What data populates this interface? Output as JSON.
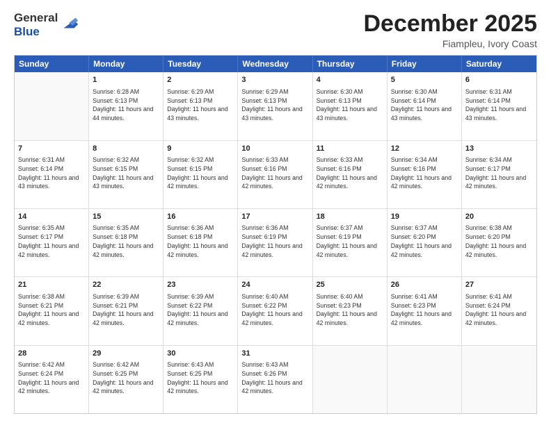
{
  "logo": {
    "general": "General",
    "blue": "Blue"
  },
  "title": "December 2025",
  "location": "Fiampleu, Ivory Coast",
  "header_days": [
    "Sunday",
    "Monday",
    "Tuesday",
    "Wednesday",
    "Thursday",
    "Friday",
    "Saturday"
  ],
  "weeks": [
    [
      {
        "day": "",
        "sunrise": "",
        "sunset": "",
        "daylight": ""
      },
      {
        "day": "1",
        "sunrise": "Sunrise: 6:28 AM",
        "sunset": "Sunset: 6:13 PM",
        "daylight": "Daylight: 11 hours and 44 minutes."
      },
      {
        "day": "2",
        "sunrise": "Sunrise: 6:29 AM",
        "sunset": "Sunset: 6:13 PM",
        "daylight": "Daylight: 11 hours and 43 minutes."
      },
      {
        "day": "3",
        "sunrise": "Sunrise: 6:29 AM",
        "sunset": "Sunset: 6:13 PM",
        "daylight": "Daylight: 11 hours and 43 minutes."
      },
      {
        "day": "4",
        "sunrise": "Sunrise: 6:30 AM",
        "sunset": "Sunset: 6:13 PM",
        "daylight": "Daylight: 11 hours and 43 minutes."
      },
      {
        "day": "5",
        "sunrise": "Sunrise: 6:30 AM",
        "sunset": "Sunset: 6:14 PM",
        "daylight": "Daylight: 11 hours and 43 minutes."
      },
      {
        "day": "6",
        "sunrise": "Sunrise: 6:31 AM",
        "sunset": "Sunset: 6:14 PM",
        "daylight": "Daylight: 11 hours and 43 minutes."
      }
    ],
    [
      {
        "day": "7",
        "sunrise": "Sunrise: 6:31 AM",
        "sunset": "Sunset: 6:14 PM",
        "daylight": "Daylight: 11 hours and 43 minutes."
      },
      {
        "day": "8",
        "sunrise": "Sunrise: 6:32 AM",
        "sunset": "Sunset: 6:15 PM",
        "daylight": "Daylight: 11 hours and 43 minutes."
      },
      {
        "day": "9",
        "sunrise": "Sunrise: 6:32 AM",
        "sunset": "Sunset: 6:15 PM",
        "daylight": "Daylight: 11 hours and 42 minutes."
      },
      {
        "day": "10",
        "sunrise": "Sunrise: 6:33 AM",
        "sunset": "Sunset: 6:16 PM",
        "daylight": "Daylight: 11 hours and 42 minutes."
      },
      {
        "day": "11",
        "sunrise": "Sunrise: 6:33 AM",
        "sunset": "Sunset: 6:16 PM",
        "daylight": "Daylight: 11 hours and 42 minutes."
      },
      {
        "day": "12",
        "sunrise": "Sunrise: 6:34 AM",
        "sunset": "Sunset: 6:16 PM",
        "daylight": "Daylight: 11 hours and 42 minutes."
      },
      {
        "day": "13",
        "sunrise": "Sunrise: 6:34 AM",
        "sunset": "Sunset: 6:17 PM",
        "daylight": "Daylight: 11 hours and 42 minutes."
      }
    ],
    [
      {
        "day": "14",
        "sunrise": "Sunrise: 6:35 AM",
        "sunset": "Sunset: 6:17 PM",
        "daylight": "Daylight: 11 hours and 42 minutes."
      },
      {
        "day": "15",
        "sunrise": "Sunrise: 6:35 AM",
        "sunset": "Sunset: 6:18 PM",
        "daylight": "Daylight: 11 hours and 42 minutes."
      },
      {
        "day": "16",
        "sunrise": "Sunrise: 6:36 AM",
        "sunset": "Sunset: 6:18 PM",
        "daylight": "Daylight: 11 hours and 42 minutes."
      },
      {
        "day": "17",
        "sunrise": "Sunrise: 6:36 AM",
        "sunset": "Sunset: 6:19 PM",
        "daylight": "Daylight: 11 hours and 42 minutes."
      },
      {
        "day": "18",
        "sunrise": "Sunrise: 6:37 AM",
        "sunset": "Sunset: 6:19 PM",
        "daylight": "Daylight: 11 hours and 42 minutes."
      },
      {
        "day": "19",
        "sunrise": "Sunrise: 6:37 AM",
        "sunset": "Sunset: 6:20 PM",
        "daylight": "Daylight: 11 hours and 42 minutes."
      },
      {
        "day": "20",
        "sunrise": "Sunrise: 6:38 AM",
        "sunset": "Sunset: 6:20 PM",
        "daylight": "Daylight: 11 hours and 42 minutes."
      }
    ],
    [
      {
        "day": "21",
        "sunrise": "Sunrise: 6:38 AM",
        "sunset": "Sunset: 6:21 PM",
        "daylight": "Daylight: 11 hours and 42 minutes."
      },
      {
        "day": "22",
        "sunrise": "Sunrise: 6:39 AM",
        "sunset": "Sunset: 6:21 PM",
        "daylight": "Daylight: 11 hours and 42 minutes."
      },
      {
        "day": "23",
        "sunrise": "Sunrise: 6:39 AM",
        "sunset": "Sunset: 6:22 PM",
        "daylight": "Daylight: 11 hours and 42 minutes."
      },
      {
        "day": "24",
        "sunrise": "Sunrise: 6:40 AM",
        "sunset": "Sunset: 6:22 PM",
        "daylight": "Daylight: 11 hours and 42 minutes."
      },
      {
        "day": "25",
        "sunrise": "Sunrise: 6:40 AM",
        "sunset": "Sunset: 6:23 PM",
        "daylight": "Daylight: 11 hours and 42 minutes."
      },
      {
        "day": "26",
        "sunrise": "Sunrise: 6:41 AM",
        "sunset": "Sunset: 6:23 PM",
        "daylight": "Daylight: 11 hours and 42 minutes."
      },
      {
        "day": "27",
        "sunrise": "Sunrise: 6:41 AM",
        "sunset": "Sunset: 6:24 PM",
        "daylight": "Daylight: 11 hours and 42 minutes."
      }
    ],
    [
      {
        "day": "28",
        "sunrise": "Sunrise: 6:42 AM",
        "sunset": "Sunset: 6:24 PM",
        "daylight": "Daylight: 11 hours and 42 minutes."
      },
      {
        "day": "29",
        "sunrise": "Sunrise: 6:42 AM",
        "sunset": "Sunset: 6:25 PM",
        "daylight": "Daylight: 11 hours and 42 minutes."
      },
      {
        "day": "30",
        "sunrise": "Sunrise: 6:43 AM",
        "sunset": "Sunset: 6:25 PM",
        "daylight": "Daylight: 11 hours and 42 minutes."
      },
      {
        "day": "31",
        "sunrise": "Sunrise: 6:43 AM",
        "sunset": "Sunset: 6:26 PM",
        "daylight": "Daylight: 11 hours and 42 minutes."
      },
      {
        "day": "",
        "sunrise": "",
        "sunset": "",
        "daylight": ""
      },
      {
        "day": "",
        "sunrise": "",
        "sunset": "",
        "daylight": ""
      },
      {
        "day": "",
        "sunrise": "",
        "sunset": "",
        "daylight": ""
      }
    ]
  ]
}
